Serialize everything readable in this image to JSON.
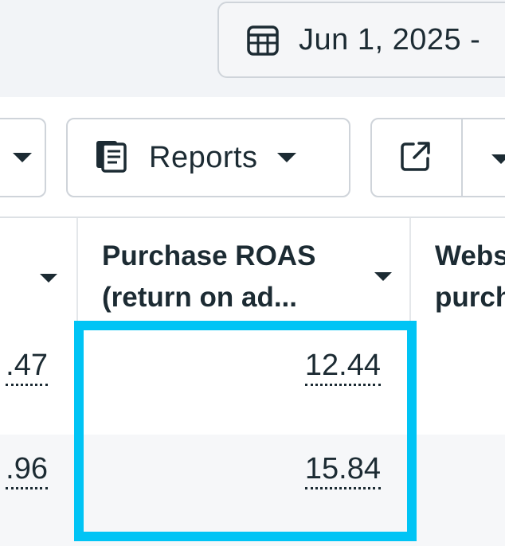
{
  "date_range": {
    "label": "Jun 1, 2025 -",
    "icon": "calendar-icon"
  },
  "toolbar": {
    "reports_label": "Reports",
    "reports_icon": "reports-icon",
    "export_icon": "export-icon"
  },
  "table": {
    "columns": [
      {
        "label": ""
      },
      {
        "label_line1": "Purchase ROAS",
        "label_line2": "(return on ad..."
      },
      {
        "label_line1": "Webs",
        "label_line2": "purch"
      }
    ],
    "rows": [
      {
        "left_value": ".47",
        "roas": "12.44"
      },
      {
        "left_value": ".96",
        "roas": "15.84"
      }
    ]
  },
  "colors": {
    "highlight": "#00c4f5",
    "text": "#1c2b33",
    "border": "#cfd4da"
  }
}
